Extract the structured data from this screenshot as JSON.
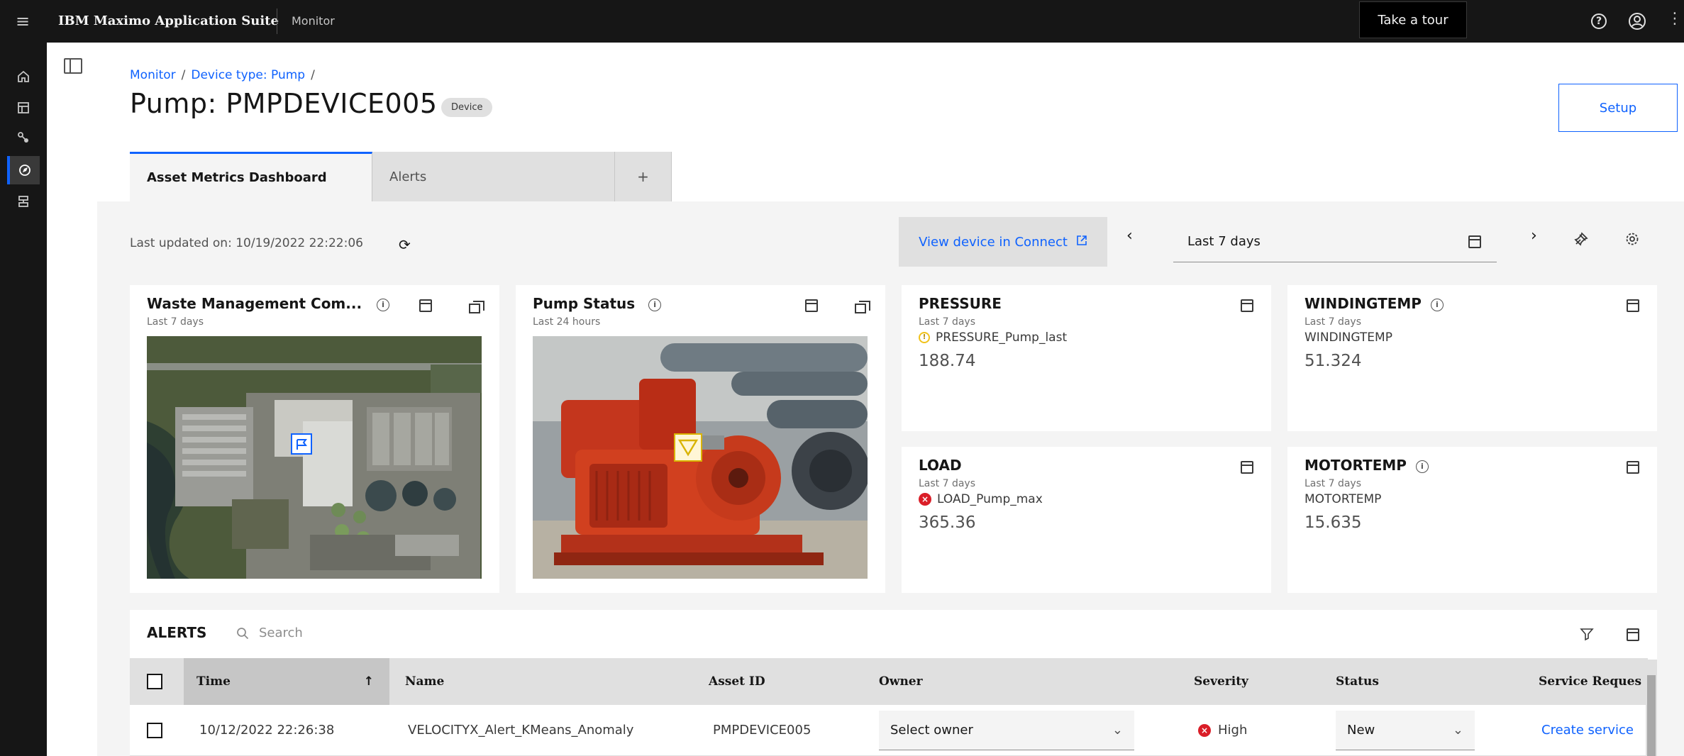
{
  "topbar": {
    "brand": "IBM Maximo Application Suite",
    "app": "Monitor",
    "tour_label": "Take a tour",
    "help_icon": "help-icon",
    "user_icon": "user-avatar-icon"
  },
  "rail": {
    "items": [
      "home-icon",
      "dashboard-icon",
      "assets-icon",
      "monitor-icon",
      "services-icon"
    ],
    "active_index": 3
  },
  "header": {
    "breadcrumb": [
      "Monitor",
      "Device type: Pump"
    ],
    "title": "Pump: PMPDEVICE005",
    "tag": "Device",
    "setup_label": "Setup"
  },
  "tabs": [
    {
      "label": "Asset Metrics Dashboard",
      "active": true
    },
    {
      "label": "Alerts",
      "active": false
    },
    {
      "label": "+",
      "active": false
    }
  ],
  "toolbar": {
    "last_updated_label": "Last updated on:",
    "last_updated_value": "10/19/2022 22:22:06",
    "view_connect_label": "View device in Connect",
    "date_range": "Last 7 days"
  },
  "cards": {
    "waste": {
      "title": "Waste Management Com...",
      "subtitle": "Last 7 days"
    },
    "pump": {
      "title": "Pump Status",
      "subtitle": "Last 24 hours"
    },
    "pressure": {
      "title": "PRESSURE",
      "subtitle": "Last 7 days",
      "metric": "PRESSURE_Pump_last",
      "value": "188.74",
      "status": "warning"
    },
    "winding": {
      "title": "WINDINGTEMP",
      "subtitle": "Last 7 days",
      "metric": "WINDINGTEMP",
      "value": "51.324"
    },
    "load": {
      "title": "LOAD",
      "subtitle": "Last 7 days",
      "metric": "LOAD_Pump_max",
      "value": "365.36",
      "status": "error"
    },
    "motor": {
      "title": "MOTORTEMP",
      "subtitle": "Last 7 days",
      "metric": "MOTORTEMP",
      "value": "15.635"
    }
  },
  "alerts": {
    "title": "ALERTS",
    "search_placeholder": "Search",
    "columns": [
      "Time",
      "Name",
      "Asset ID",
      "Owner",
      "Severity",
      "Status",
      "Service Reques"
    ],
    "rows": [
      {
        "time": "10/12/2022 22:26:38",
        "name": "VELOCITYX_Alert_KMeans_Anomaly",
        "asset_id": "PMPDEVICE005",
        "owner": "Select owner",
        "severity": "High",
        "status": "New",
        "service": "Create service"
      }
    ]
  },
  "colors": {
    "accent": "#0f62fe",
    "error": "#da1e28",
    "warning": "#f1c21b",
    "topbar": "#161616"
  }
}
